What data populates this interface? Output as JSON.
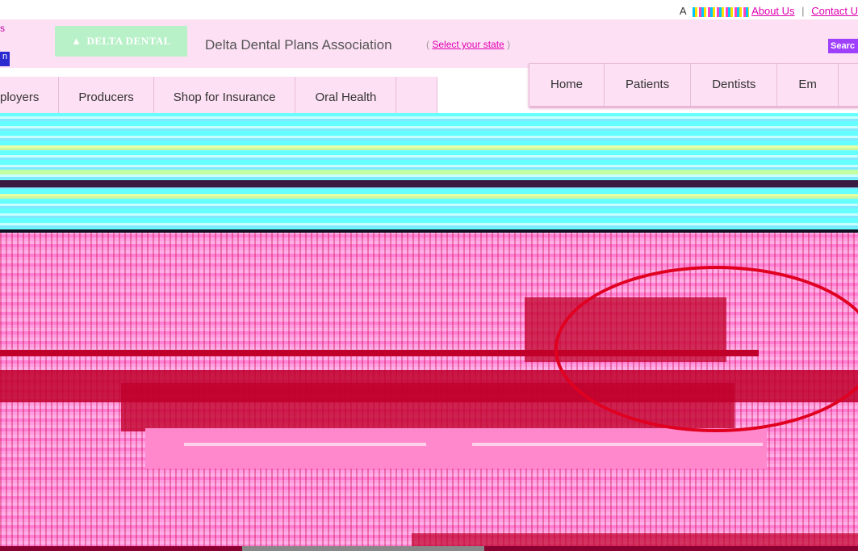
{
  "utility": {
    "a_label": "A",
    "about_link": "About Us",
    "contact_link": "Contact U"
  },
  "header": {
    "left_mark": "s",
    "left_block": "n",
    "logo_text": "DELTA DENTAL",
    "logo_icon": "delta-triangle-icon",
    "association": "Delta Dental Plans Association",
    "state_open": "(",
    "state_link": "Select your state",
    "state_close": ")",
    "search_label": "Searc"
  },
  "nav_primary": [
    "Home",
    "Patients",
    "Dentists",
    "Em"
  ],
  "nav_secondary": [
    "ployers",
    "Producers",
    "Shop for Insurance",
    "Oral Health"
  ],
  "colors": {
    "background": "#ffffff",
    "header_bg": "#fde0f4",
    "link": "#e000b0",
    "accent_red": "#e00020"
  }
}
